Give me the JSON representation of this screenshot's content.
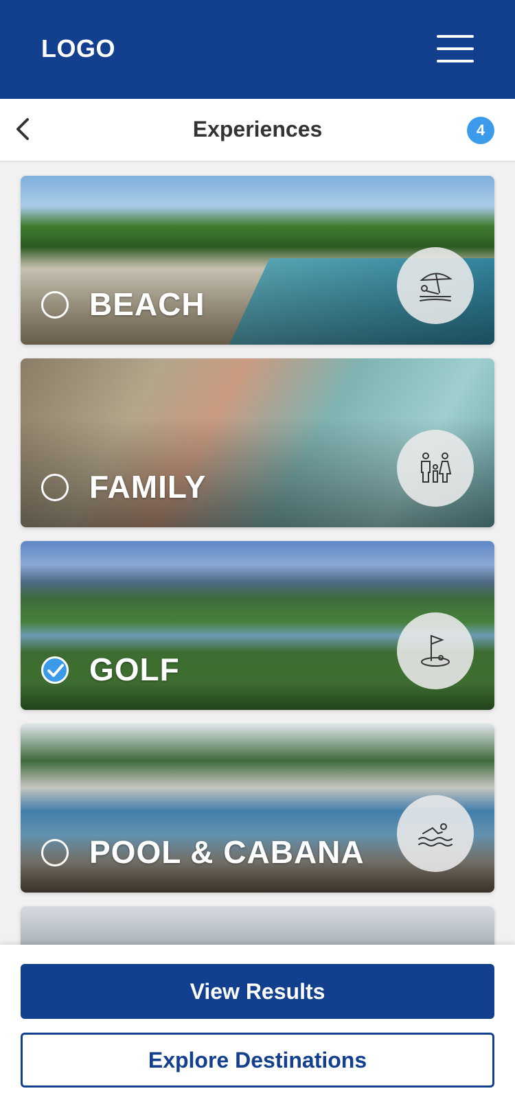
{
  "header": {
    "logo": "LOGO",
    "menu_icon": "hamburger-menu-icon"
  },
  "subheader": {
    "back_icon": "chevron-left-icon",
    "title": "Experiences",
    "badge_count": "4"
  },
  "experiences": [
    {
      "label": "BEACH",
      "selected": false,
      "icon": "beach-umbrella-icon"
    },
    {
      "label": "FAMILY",
      "selected": false,
      "icon": "family-icon"
    },
    {
      "label": "GOLF",
      "selected": true,
      "icon": "golf-flag-icon"
    },
    {
      "label": "POOL & CABANA",
      "selected": false,
      "icon": "swimmer-icon"
    }
  ],
  "actions": {
    "view_results": "View Results",
    "explore_destinations": "Explore Destinations"
  },
  "colors": {
    "brand_blue": "#133f8f",
    "accent_blue": "#3b9bea"
  }
}
